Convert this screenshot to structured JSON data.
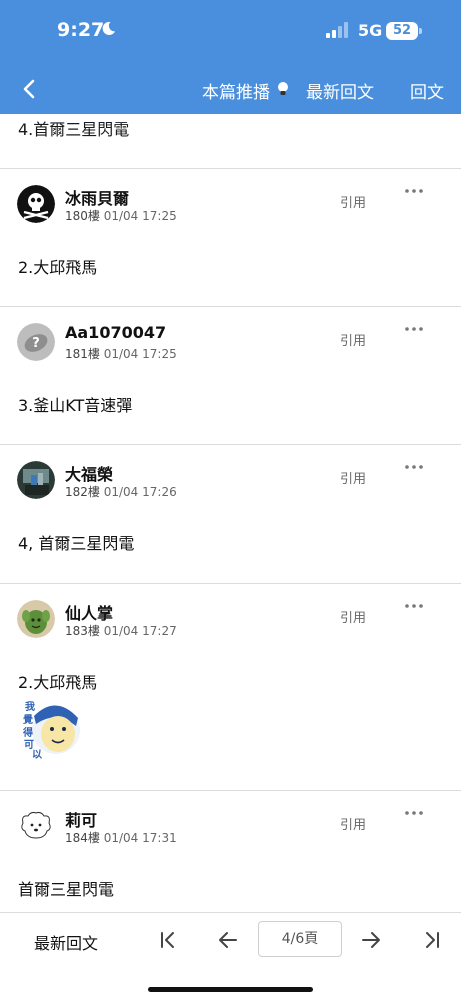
{
  "status_bar": {
    "time": "9:27",
    "network": "5G",
    "battery": "52"
  },
  "nav": {
    "push_label": "本篇推播",
    "latest_label": "最新回文",
    "reply_label": "回文"
  },
  "partial_post": {
    "text": "4.首爾三星閃電"
  },
  "posts": [
    {
      "author": "冰雨貝爾",
      "floor": "180樓",
      "time": "01/04 17:25",
      "quote": "引用",
      "text": "2.大邱飛馬"
    },
    {
      "author": "Aa1070047",
      "floor": "181樓",
      "time": "01/04 17:25",
      "quote": "引用",
      "text": "3.釜山KT音速彈"
    },
    {
      "author": "大福榮",
      "floor": "182樓",
      "time": "01/04 17:26",
      "quote": "引用",
      "text": "4, 首爾三星閃電"
    },
    {
      "author": "仙人掌",
      "floor": "183樓",
      "time": "01/04 17:27",
      "quote": "引用",
      "text": "2.大邱飛馬",
      "sticker_text": "我覺得可以"
    },
    {
      "author": "莉可",
      "floor": "184樓",
      "time": "01/04 17:31",
      "quote": "引用",
      "text": "首爾三星閃電"
    }
  ],
  "bottom_bar": {
    "latest_label": "最新回文",
    "page": "4/6頁"
  },
  "colors": {
    "header": "#4a8fde",
    "divider": "#dcdcdc"
  }
}
